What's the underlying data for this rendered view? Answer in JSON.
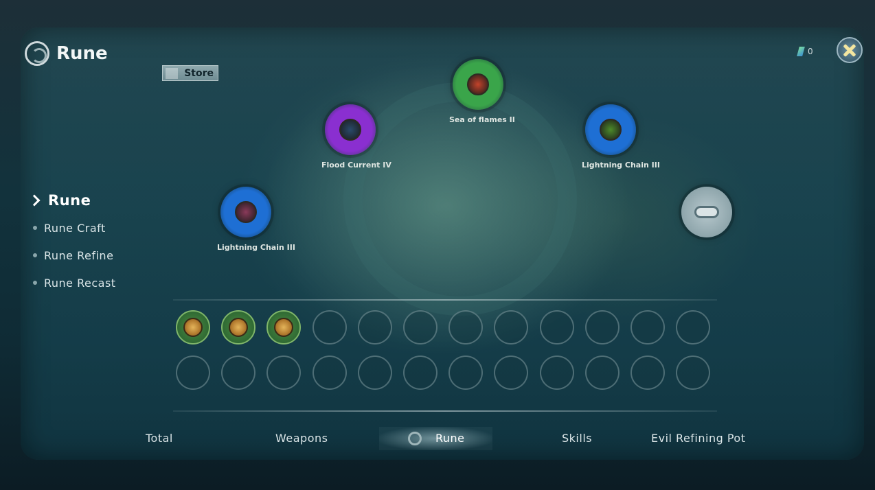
{
  "header": {
    "title": "Rune",
    "store_label": "Store",
    "currency_value": "0"
  },
  "side_nav": [
    {
      "label": "Rune",
      "active": true
    },
    {
      "label": "Rune Craft",
      "active": false
    },
    {
      "label": "Rune Refine",
      "active": false
    },
    {
      "label": "Rune Recast",
      "active": false
    }
  ],
  "equipped_runes": [
    {
      "name": "Sea of flames II",
      "color": "#3aa54a",
      "core_color": "#c4432b"
    },
    {
      "name": "Flood Current IV",
      "color": "#8a2fd0",
      "core_color": "#2a4a6a"
    },
    {
      "name": "Lightning Chain III",
      "color": "#1e6fd4",
      "core_color": "#4d8a2a"
    },
    {
      "name": "Lightning Chain III",
      "color": "#1e6fd4",
      "core_color": "#8a3a5a"
    },
    {
      "name": "",
      "color": "#9fb3b8",
      "core_color": "#dbe4e6"
    }
  ],
  "inventory": {
    "filled_cells": 3,
    "total_cells": 24
  },
  "bottom_tabs": [
    {
      "label": "Total",
      "active": false
    },
    {
      "label": "Weapons",
      "active": false
    },
    {
      "label": "Rune",
      "active": true
    },
    {
      "label": "Skills",
      "active": false
    },
    {
      "label": "Evil Refining Pot",
      "active": false
    }
  ]
}
